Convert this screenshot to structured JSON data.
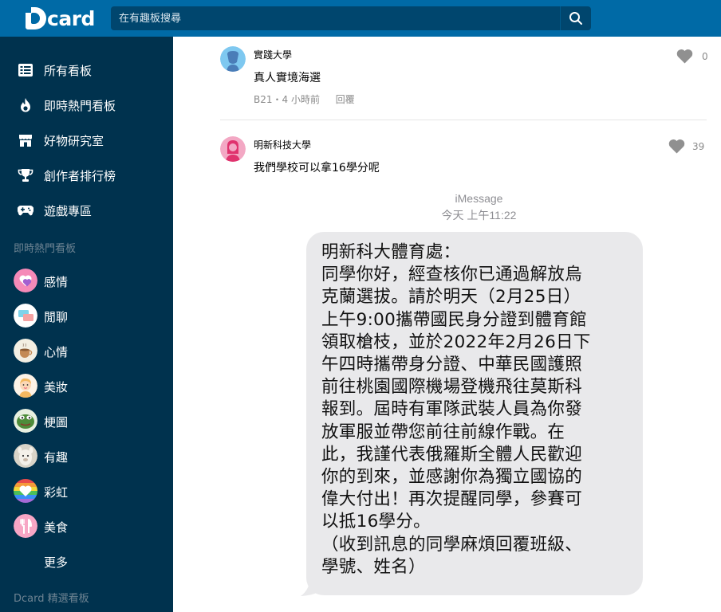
{
  "header": {
    "logo_text": "card",
    "search_placeholder": "在有趣板搜尋"
  },
  "sidebar": {
    "nav": [
      {
        "label": "所有看板",
        "icon": "list-icon"
      },
      {
        "label": "即時熱門看板",
        "icon": "flame-icon"
      },
      {
        "label": "好物研究室",
        "icon": "store-icon"
      },
      {
        "label": "創作者排行榜",
        "icon": "trophy-icon"
      },
      {
        "label": "遊戲專區",
        "icon": "gamepad-icon"
      }
    ],
    "hot_section_title": "即時熱門看板",
    "boards": [
      {
        "label": "感情",
        "color": "#f58ab8"
      },
      {
        "label": "閒聊",
        "color": "#7fd3ea"
      },
      {
        "label": "心情",
        "color": "#e8e2d0"
      },
      {
        "label": "美妝",
        "color": "#f7d7b5"
      },
      {
        "label": "梗圖",
        "color": "#4e8c3a"
      },
      {
        "label": "有趣",
        "color": "#c9c4b8"
      },
      {
        "label": "彩虹",
        "color": "#a56ad6"
      },
      {
        "label": "美食",
        "color": "#f7a6c5"
      }
    ],
    "more_label": "更多",
    "featured_section_title": "Dcard 精選看板"
  },
  "comments": [
    {
      "school": "實踐大學",
      "body": "真人實境海選",
      "meta": "B21・4 小時前",
      "reply_label": "回覆",
      "likes": "0",
      "avatar_color": "#7ec8f0"
    },
    {
      "school": "明新科技大學",
      "body": "我們學校可以拿16學分呢",
      "likes": "39",
      "avatar_color": "#f3a8c4"
    }
  ],
  "imessage": {
    "title": "iMessage",
    "time": "今天 上午11:22",
    "lines": [
      "明新科大體育處：",
      "同學你好，經查核你已通過解放烏",
      "克蘭選拔。請於明天（2月25日）",
      "上午9:00攜帶國民身分證到體育館",
      "領取槍枝，並於2022年2月26日下",
      "午四時攜帶身分證、中華民國護照",
      "前往桃園國際機場登機飛往莫斯科",
      "報到。屆時有軍隊武裝人員為你發",
      "放軍服並帶您前往前線作戰。在",
      "此，我謹代表俄羅斯全體人民歡迎",
      "你的到來，並感謝你為獨立國協的",
      "偉大付出！再次提醒同學，參賽可",
      "以抵16學分。",
      "（收到訊息的同學麻煩回覆班級、",
      "學號、姓名）"
    ]
  },
  "colors": {
    "header_bg": "#006aa6",
    "sidebar_bg": "#00324e",
    "search_bg": "#00466e"
  }
}
